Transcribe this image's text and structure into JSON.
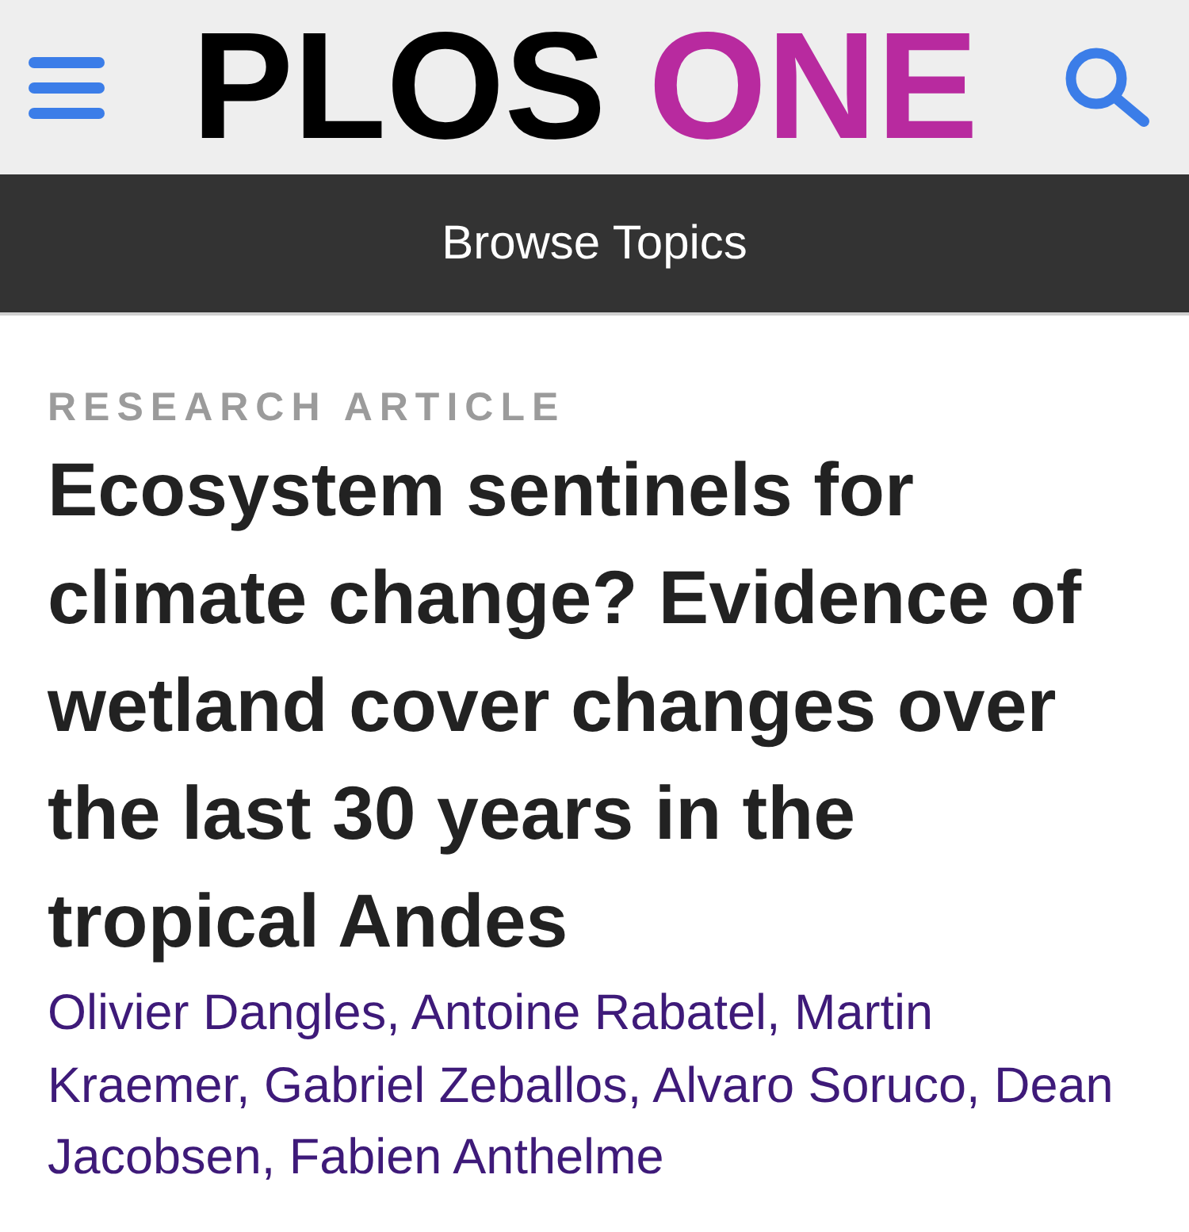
{
  "header": {
    "logo": [
      "PLOS",
      "ONE"
    ]
  },
  "nav": {
    "label": "Browse Topics"
  },
  "article": {
    "type_label": "RESEARCH ARTICLE",
    "title": "Ecosystem sentinels for climate change? Evidence of wetland cover changes over the last 30 years in the tropical Andes",
    "authors": "Olivier Dangles, Antoine Rabatel, Martin Kraemer, Gabriel Zeballos, Alvaro Soruco, Dean Jacobsen, Fabien Anthelme"
  }
}
